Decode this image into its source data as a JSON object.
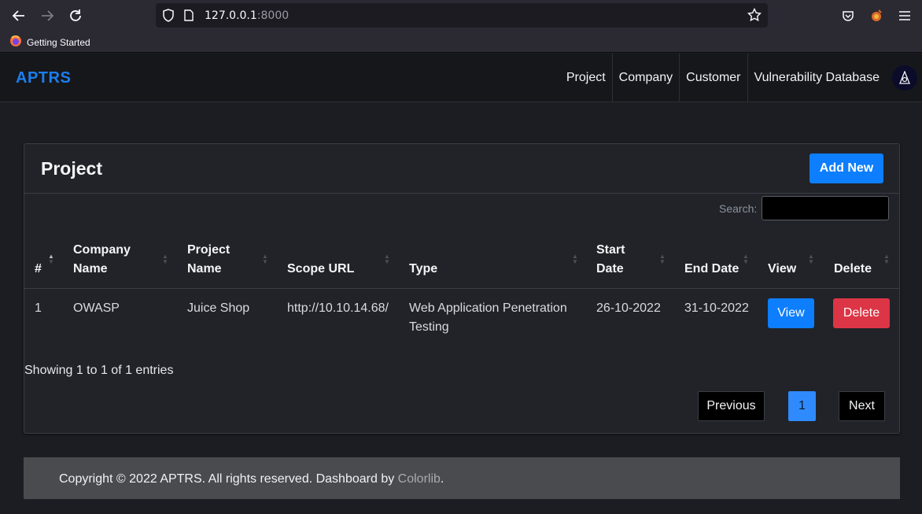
{
  "browser": {
    "url_host": "127.0.0.1",
    "url_port": ":8000",
    "bookmark_label": "Getting Started"
  },
  "nav": {
    "brand": "APTRS",
    "links": [
      "Project",
      "Company",
      "Customer",
      "Vulnerability Database"
    ]
  },
  "card": {
    "title": "Project",
    "add_button": "Add New",
    "search_label": "Search:",
    "search_value": ""
  },
  "table": {
    "headers": {
      "num": "#",
      "company_1": "Company",
      "company_2": "Name",
      "project_1": "Project",
      "project_2": "Name",
      "scope": "Scope URL",
      "type": "Type",
      "start_1": "Start",
      "start_2": "Date",
      "end": "End Date",
      "view": "View",
      "delete": "Delete"
    },
    "rows": [
      {
        "num": "1",
        "company": "OWASP",
        "project": "Juice Shop",
        "scope": "http://10.10.14.68/",
        "type_1": "Web Application Penetration",
        "type_2": "Testing",
        "start": "26-10-2022",
        "end": "31-10-2022",
        "view_label": "View",
        "delete_label": "Delete"
      }
    ]
  },
  "pagination": {
    "info": "Showing 1 to 1 of 1 entries",
    "previous": "Previous",
    "current": "1",
    "next": "Next"
  },
  "footer": {
    "text": "Copyright © 2022 APTRS. All rights reserved. Dashboard by ",
    "link": "Colorlib",
    "end": "."
  },
  "colors": {
    "primary": "#0d7efd",
    "danger": "#dc3545",
    "brand": "#1b7ff0"
  }
}
